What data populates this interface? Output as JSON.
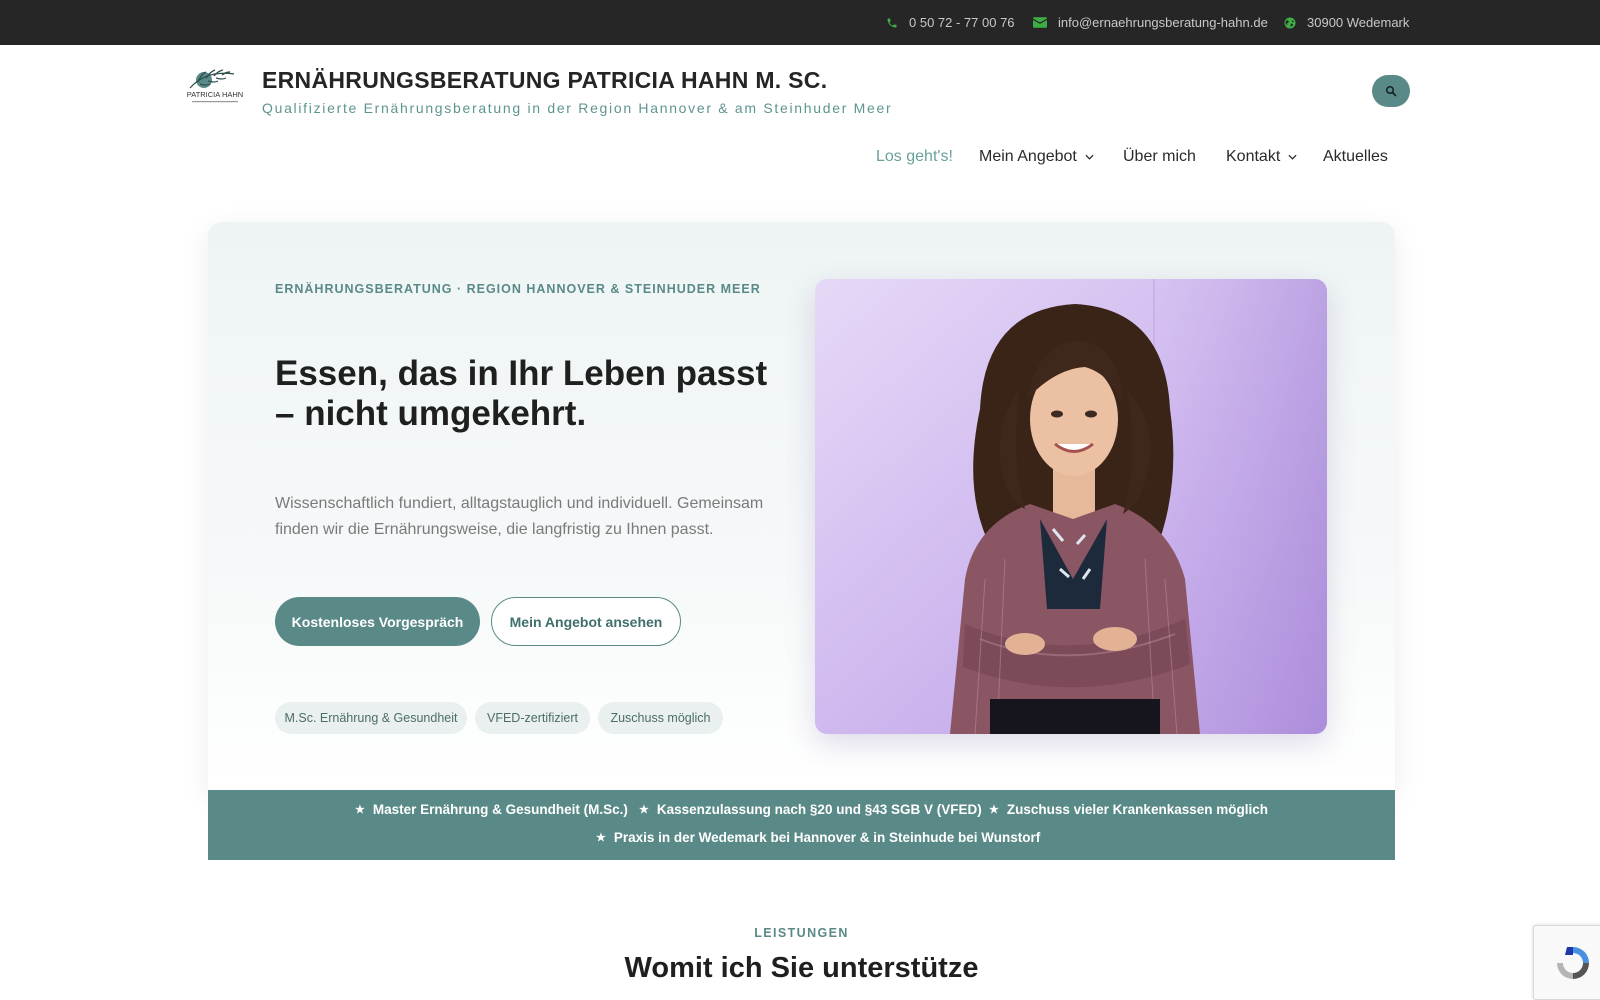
{
  "topbar": {
    "phone": "0 50 72 - 77 00 76",
    "email": "info@ernaehrungsberatung-hahn.de",
    "location": "30900 Wedemark",
    "icon_color": "#3fae49"
  },
  "header": {
    "logo_text": "PATRICIA HAHN",
    "title": "ERNÄHRUNGSBERATUNG PATRICIA HAHN M. SC.",
    "tagline": "Qualifizierte Ernährungsberatung in der Region Hannover & am Steinhuder Meer",
    "search_icon": "search-icon"
  },
  "nav": {
    "items": [
      {
        "label": "Los geht's!",
        "active": true,
        "has_dropdown": false
      },
      {
        "label": "Mein Angebot",
        "active": false,
        "has_dropdown": true
      },
      {
        "label": "Über mich",
        "active": false,
        "has_dropdown": false
      },
      {
        "label": "Kontakt",
        "active": false,
        "has_dropdown": true
      },
      {
        "label": "Aktuelles",
        "active": false,
        "has_dropdown": false
      }
    ]
  },
  "hero": {
    "eyebrow": "ERNÄHRUNGSBERATUNG · REGION HANNOVER & STEINHUDER MEER",
    "headline": "Essen, das in Ihr Leben passt – nicht umgekehrt.",
    "lead": "Wissenschaftlich fundiert, alltagstauglich und individuell. Gemeinsam finden wir die Ernährungsweise, die langfristig zu Ihnen passt.",
    "primary_button": "Kostenloses Vorgespräch",
    "secondary_button": "Mein Angebot ansehen",
    "chips": [
      "M.Sc. Ernährung & Gesundheit",
      "VFED-zertifiziert",
      "Zuschuss möglich"
    ]
  },
  "trust_band": {
    "items": [
      "Master Ernährung & Gesundheit (M.Sc.)",
      "Kassenzulassung nach §20 und §43 SGB V (VFED)",
      "Zuschuss vieler Krankenkassen möglich",
      "Praxis in der Wedemark bei Hannover & in Steinhude bei Wunstorf"
    ]
  },
  "section": {
    "eyebrow": "LEISTUNGEN",
    "title": "Womit ich Sie unterstütze"
  },
  "colors": {
    "accent": "#5a8a87",
    "topbar_bg": "#262626",
    "photo_bg": "#cdb6ee"
  }
}
